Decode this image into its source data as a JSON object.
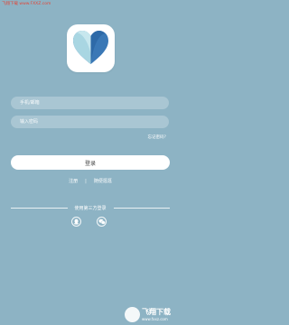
{
  "watermark_top": "飞翔下载 www.FXXZ.com",
  "login": {
    "phone_placeholder": "手机/邮箱",
    "password_placeholder": "输入密码",
    "forgot_password": "忘记密码？",
    "login_button": "登录"
  },
  "links": {
    "register": "注册",
    "separator": "|",
    "browse": "随便逛逛"
  },
  "third_party": {
    "label": "使用第三方登录",
    "providers": [
      {
        "name": "QQ",
        "icon": "qq-icon"
      },
      {
        "name": "WeChat",
        "icon": "wechat-icon"
      }
    ]
  },
  "brand_watermark": {
    "title": "飞翔下载",
    "url": "www.fxxz.com"
  },
  "colors": {
    "background": "#8db3c4",
    "heart_dark": "#3a78b6",
    "heart_light": "#a9d6e2"
  }
}
